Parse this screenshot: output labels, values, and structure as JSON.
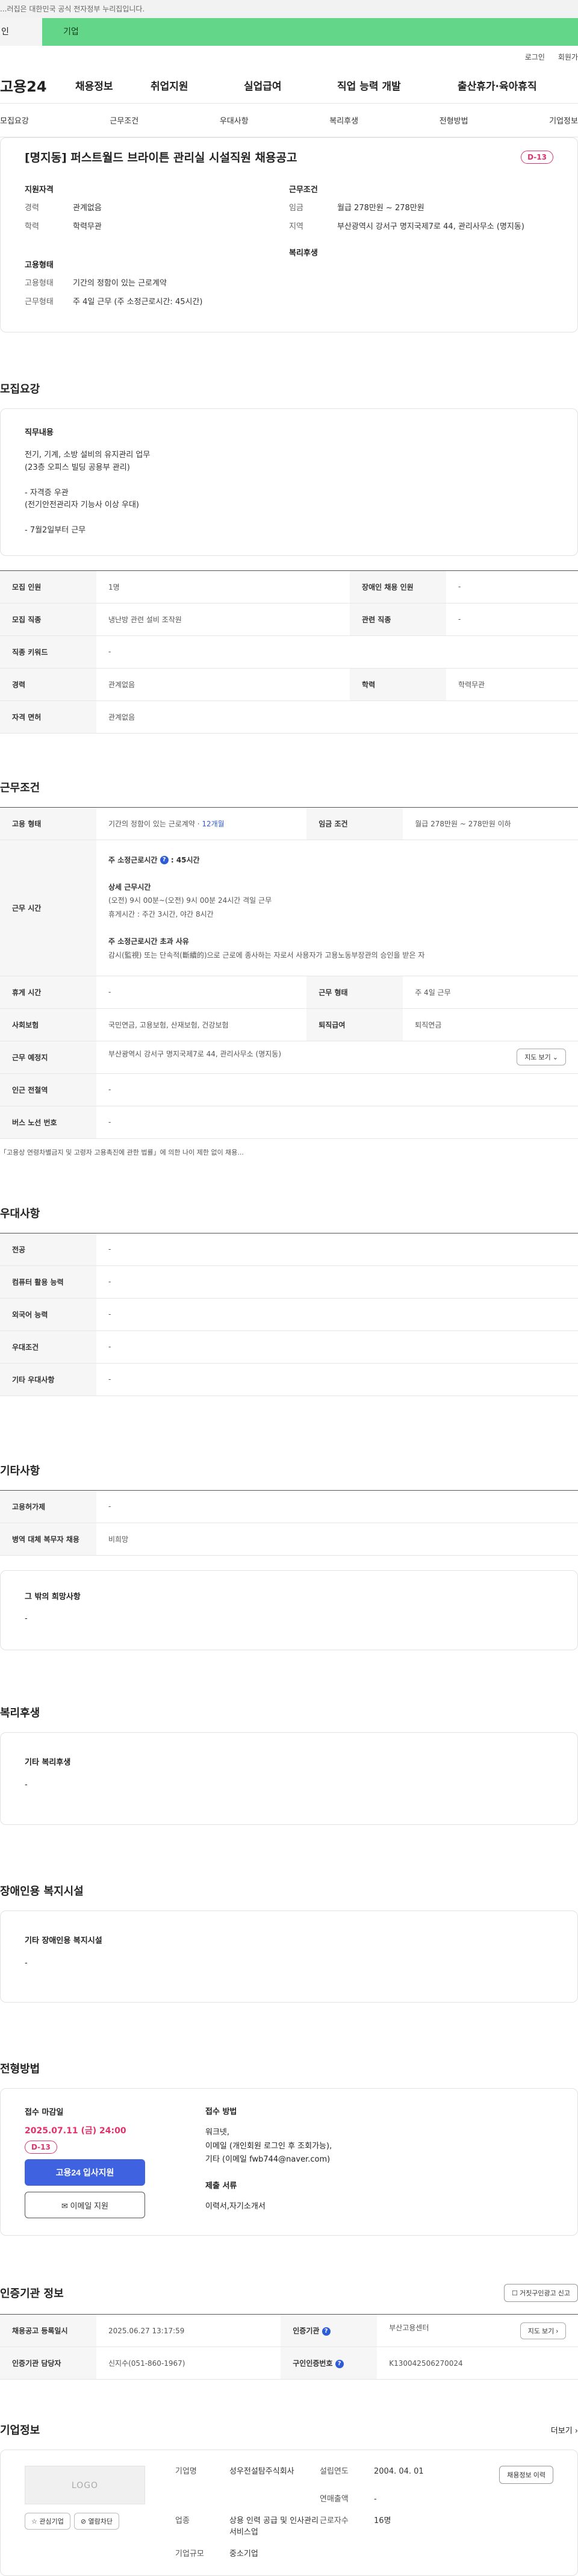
{
  "notice": "...러집은 대한민국 공식 전자정부 누리집입니다.",
  "tabs": {
    "person": "인",
    "company": "기업"
  },
  "util": {
    "login": "로그인",
    "join": "회원가"
  },
  "gnb": {
    "logo": "고용24",
    "menu": [
      "채용정보",
      "취업지원",
      "실업급여",
      "직업 능력 개발",
      "출산휴가·육아휴직"
    ]
  },
  "subnav": [
    "모집요강",
    "근무조건",
    "우대사항",
    "복리후생",
    "전형방법",
    "기업정보"
  ],
  "job": {
    "title": "[명지동] 퍼스트월드 브라이튼 관리실 시설직원 채용공고",
    "dday": "D-13",
    "summary": {
      "qual_title": "지원자격",
      "career_label": "경력",
      "career": "관계없음",
      "edu_label": "학력",
      "edu": "학력무관",
      "cond_title": "근무조건",
      "wage_label": "임금",
      "wage": "월급 278만원 ~ 278만원",
      "place_label": "지역",
      "place": "부산광역시 강서구 명지국제7로 44, 관리사무소 (명지동)",
      "type_title": "고용형태",
      "type_label": "고용형태",
      "type": "기간의 정함이 있는 근로계약",
      "hours_label": "근무형태",
      "hours": "주 4일 근무 (주 소정근로시간: 45시간)",
      "welfare_title": "복리후생"
    }
  },
  "recruit": {
    "title": "모집요강",
    "duty_title": "직무내용",
    "duty": "전기, 기계, 소방 설비의 유지관리 업무\n(23층 오피스 빌딩 공용부 관리)\n\n- 자격증 우관\n  (전기안전관리자 기능사 이상 우대)\n\n- 7월2일부터 근무",
    "rows": [
      {
        "k1": "모집 인원",
        "v1": "1명",
        "k2": "장애인 채용 인원",
        "v2": "-"
      },
      {
        "k1": "모집 직종",
        "v1": "냉난방 관련 설비 조작원",
        "k2": "관련 직종",
        "v2": "-"
      },
      {
        "k1": "직종 키워드",
        "v1": "-"
      },
      {
        "k1": "경력",
        "v1": "관계없음",
        "k2": "학력",
        "v2": "학력무관"
      },
      {
        "k1": "자격 면허",
        "v1": "관계없음"
      }
    ]
  },
  "work": {
    "title": "근무조건",
    "type_label": "고용 형태",
    "type_value": "기간의 정함이 있는 근로계약 · ",
    "type_months": "12개월",
    "wage_label": "임금 조건",
    "wage_value": "월급 278만원 ~ 278만원 이하",
    "hours_label": "근무 시간",
    "weekly_title": "주 소정근로시간",
    "weekly_value": "45시간",
    "detail_title": "상세 근무시간",
    "detail_1": "(오전) 9시 00분~(오전) 9시 00분 24시간 격일 근무",
    "detail_2": "휴게시간 : 주간 3시간, 야간 8시간",
    "over_title": "주 소정근로시간 초과 사유",
    "over_value": "감시(監視) 또는 단속적(斷續的)으로 근로에 종사하는 자로서 사용자가 고용노동부장관의 승인을 받은 자",
    "rest_label": "휴게 시간",
    "rest_value": "-",
    "form_label": "근무 형태",
    "form_value": "주 4일 근무",
    "ins_label": "사회보험",
    "ins_value": "국민연금, 고용보험, 산재보험, 건강보험",
    "pension_label": "퇴직급여",
    "pension_value": "퇴직연금",
    "loc_label": "근무 예정지",
    "loc_value": "부산광역시 강서구 명지국제7로 44, 관리사무소 (명지동)",
    "map_btn": "지도 보기 ⌄",
    "station_label": "인근 전철역",
    "station_value": "-",
    "bus_label": "버스 노선 번호",
    "bus_value": "-",
    "footnote": "「고용상 연령차별금지 및 고령자 고용촉진에 관한 법률」에 의한 나이 제한 없이 채용..."
  },
  "pref": {
    "title": "우대사항",
    "rows": [
      {
        "k": "전공",
        "v": "-"
      },
      {
        "k": "컴퓨터 활용 능력",
        "v": "-"
      },
      {
        "k": "외국어 능력",
        "v": "-"
      },
      {
        "k": "우대조건",
        "v": "-"
      },
      {
        "k": "기타 우대사항",
        "v": "-"
      }
    ]
  },
  "etc": {
    "title": "기타사항",
    "rows": [
      {
        "k": "고용허가제",
        "v": "-"
      },
      {
        "k": "병역 대체 복무자 채용",
        "v": "비희망"
      }
    ],
    "other_title": "그 밖의 희망사항",
    "other_value": "-"
  },
  "welfare": {
    "title": "복리후생",
    "box_title": "기타 복리후생",
    "box_value": "-"
  },
  "disabled": {
    "title": "장애인용 복지시설",
    "box_title": "기타 장애인용 복지시설",
    "box_value": "-"
  },
  "apply": {
    "title": "전형방법",
    "deadline_title": "접수 마감일",
    "deadline": "2025.07.11 (금) 24:00",
    "dday": "D-13",
    "apply_btn": "고용24 입사지원",
    "email_btn": "✉ 이메일 지원",
    "method_title": "접수 방법",
    "method": "워크넷,\n이메일 (개인회원 로그인 후 조회가능),\n기타 (이메일 fwb744@naver.com)",
    "docs_title": "제출 서류",
    "docs": "이력서,자기소개서"
  },
  "cert": {
    "title": "인증기관 정보",
    "report_btn": "☐ 거짓구인광고 신고",
    "reg_label": "채용공고 등록일시",
    "reg_value": "2025.06.27 13:17:59",
    "org_label": "인증기관",
    "org_value": "부산고용센터",
    "map_btn": "지도 보기 ›",
    "staff_label": "인증기관 담당자",
    "staff_value": "신지수(051-860-1967)",
    "num_label": "구인인증번호",
    "num_value": "K130042506270024"
  },
  "company": {
    "title": "기업정보",
    "more": "더보기 ›",
    "logo": "LOGO",
    "fav_btn": "☆ 관심기업",
    "block_btn": "⊘ 열람차단",
    "name_label": "기업명",
    "name_value": "성우전설탐주식회사",
    "est_label": "설립연도",
    "est_value": "2004. 04. 01",
    "sales_label": "연매출액",
    "sales_value": "-",
    "industry_label": "업종",
    "industry_value": "상용 인력 공급 및 인사관리 서비스업",
    "emp_label": "근로자수",
    "emp_value": "16명",
    "size_label": "기업규모",
    "size_value": "중소기업",
    "history_btn": "채용정보 이력"
  }
}
